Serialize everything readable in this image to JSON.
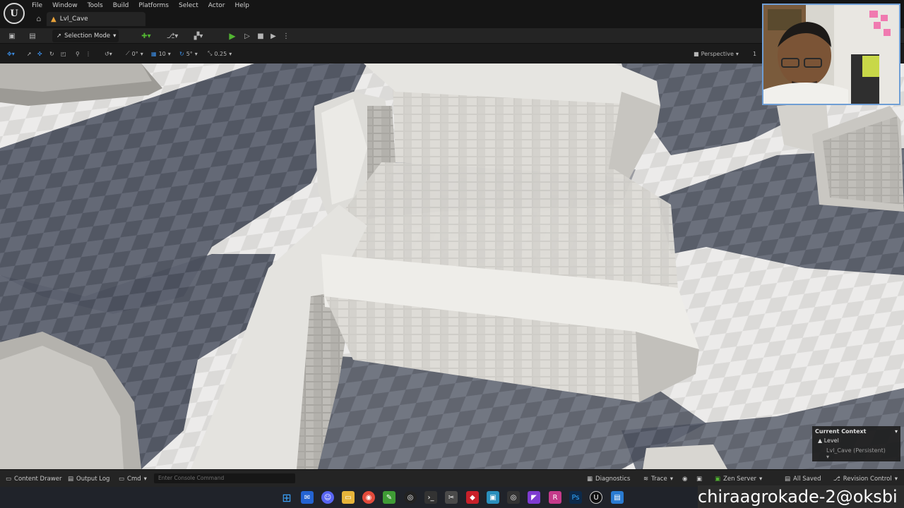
{
  "menu": [
    "File",
    "Window",
    "Tools",
    "Build",
    "Platforms",
    "Select",
    "Actor",
    "Help"
  ],
  "tab": {
    "label": "Lvl_Cave",
    "icon": "level-icon"
  },
  "toolbar": {
    "selection_mode": "Selection Mode"
  },
  "viewport_toolbar": {
    "rotate_snap": "0°",
    "grid_snap": "10",
    "angle_snap": "5°",
    "scale_snap": "0.25",
    "view_mode": "Perspective",
    "extra": "1"
  },
  "context": {
    "title": "Current Context",
    "level": "Level",
    "sub": "Lvl_Cave (Persistent)"
  },
  "statusbar": {
    "content_drawer": "Content Drawer",
    "output_log": "Output Log",
    "cmd": "Cmd",
    "console_placeholder": "Enter Console Command",
    "diagnostics": "Diagnostics",
    "trace": "Trace",
    "zen_server": "Zen Server",
    "all_saved": "All Saved",
    "revision_control": "Revision Control"
  },
  "overlay": {
    "text": "chiraagrokade-2@oksbi"
  },
  "colors": {
    "accent": "#3b8ee6",
    "play": "#52b532",
    "tab_icon": "#e8a23a"
  }
}
